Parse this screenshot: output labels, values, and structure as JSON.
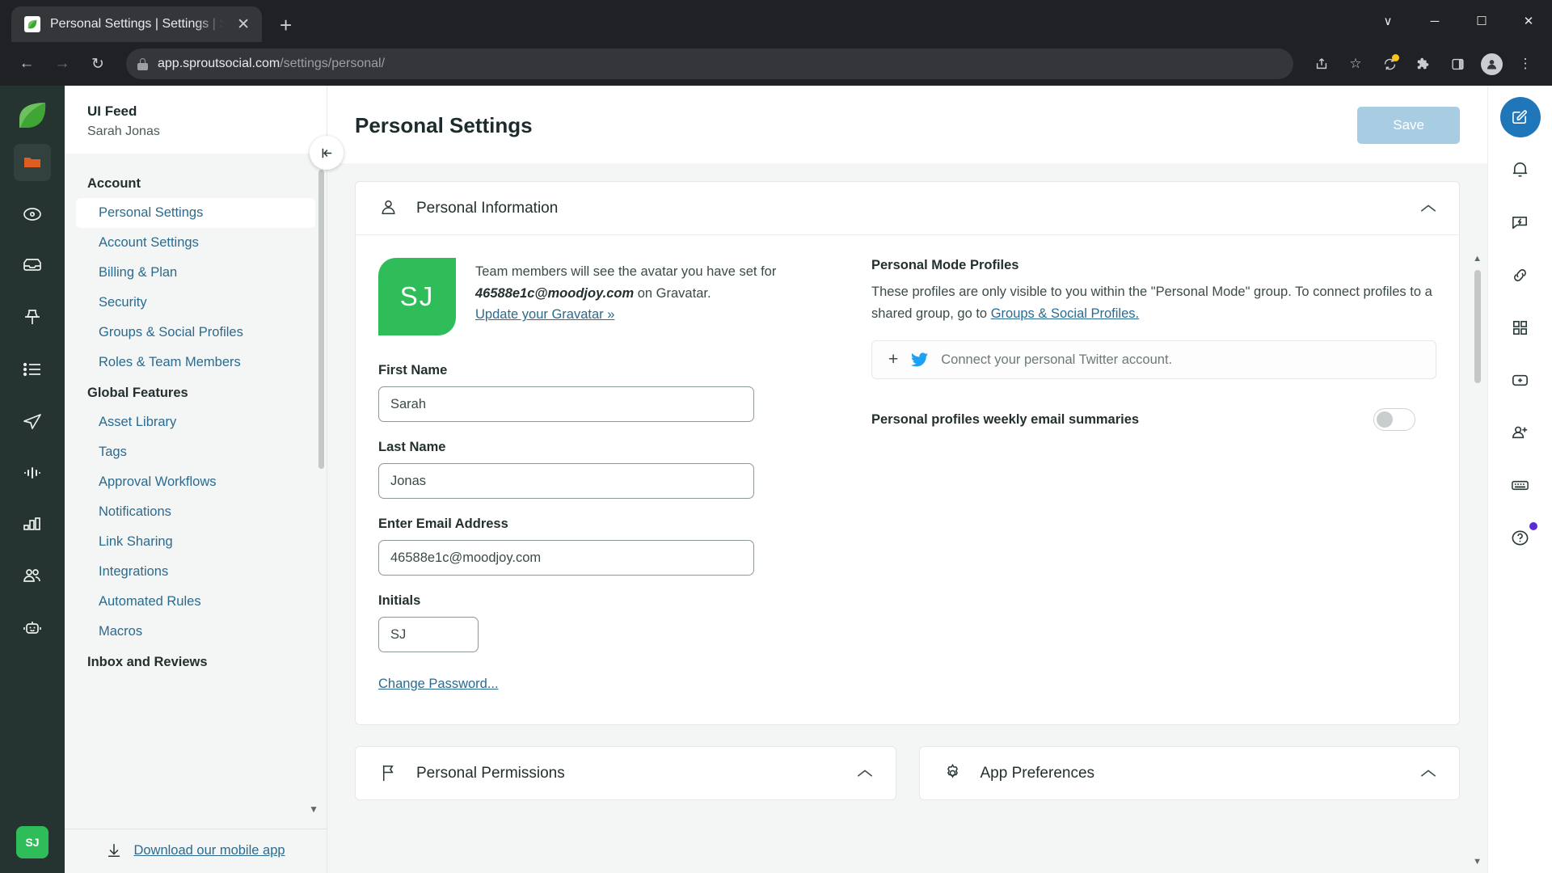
{
  "browser": {
    "tab_title": "Personal Settings | Settings | Spr",
    "tab_close": "✕",
    "new_tab": "+",
    "url_host": "app.sproutsocial.com",
    "url_path": "/settings/personal/",
    "window_minimize": "─",
    "window_maximize": "☐",
    "window_close": "✕",
    "window_chevron": "∨",
    "back": "←",
    "forward": "→",
    "reload": "↻",
    "share_icon": "share-icon",
    "bookmark_icon": "☆",
    "extensions_icon": "🧩",
    "sidepanel_icon": "◨",
    "menu_icon": "⋮"
  },
  "left_rail": {
    "logo": "sprout-leaf-logo",
    "items": [
      "folder-icon",
      "compass-icon",
      "inbox-icon",
      "pin-icon",
      "list-icon",
      "send-icon",
      "pulse-icon",
      "bar-chart-icon",
      "people-icon",
      "bot-icon"
    ],
    "avatar_initials": "SJ"
  },
  "sidebar": {
    "org": "UI Feed",
    "user": "Sarah Jonas",
    "collapse_icon": "|←",
    "groups": [
      {
        "title": "Account",
        "items": [
          {
            "label": "Personal Settings",
            "selected": true
          },
          {
            "label": "Account Settings",
            "selected": false
          },
          {
            "label": "Billing & Plan",
            "selected": false
          },
          {
            "label": "Security",
            "selected": false
          },
          {
            "label": "Groups & Social Profiles",
            "selected": false
          },
          {
            "label": "Roles & Team Members",
            "selected": false
          }
        ]
      },
      {
        "title": "Global Features",
        "items": [
          {
            "label": "Asset Library",
            "selected": false
          },
          {
            "label": "Tags",
            "selected": false
          },
          {
            "label": "Approval Workflows",
            "selected": false
          },
          {
            "label": "Notifications",
            "selected": false
          },
          {
            "label": "Link Sharing",
            "selected": false
          },
          {
            "label": "Integrations",
            "selected": false
          },
          {
            "label": "Automated Rules",
            "selected": false
          },
          {
            "label": "Macros",
            "selected": false
          }
        ]
      },
      {
        "title": "Inbox and Reviews",
        "items": []
      }
    ],
    "footer_link": "Download our mobile app",
    "footer_icon": "download-icon",
    "scroll_caret": "▼"
  },
  "header": {
    "title": "Personal Settings",
    "save_label": "Save"
  },
  "personal_information": {
    "card_title": "Personal Information",
    "card_icon": "person-icon",
    "collapse_chevron": "∧",
    "avatar_initials": "SJ",
    "gravatar_text_1": "Team members will see the avatar you have set for",
    "gravatar_email": "46588e1c@moodjoy.com",
    "gravatar_text_2": " on Gravatar.",
    "gravatar_link": "Update your Gravatar »",
    "fields": [
      {
        "label": "First Name",
        "value": "Sarah",
        "size": "lg"
      },
      {
        "label": "Last Name",
        "value": "Jonas",
        "size": "lg"
      },
      {
        "label": "Enter Email Address",
        "value": "46588e1c@moodjoy.com",
        "size": "lg"
      },
      {
        "label": "Initials",
        "value": "SJ",
        "size": "sm"
      }
    ],
    "change_password": "Change Password..."
  },
  "personal_mode": {
    "title": "Personal Mode Profiles",
    "desc_1": "These profiles are only visible to you within the \"Personal Mode\" group. To connect profiles to a shared group, go to ",
    "desc_link": "Groups & Social Profiles.",
    "connect_label": "Connect your personal Twitter account.",
    "connect_plus": "+",
    "twitter_icon": "twitter-icon",
    "toggle_label": "Personal profiles weekly email summaries",
    "toggle_on": false
  },
  "bottom_cards": [
    {
      "title": "Personal Permissions",
      "icon": "flag-icon",
      "chevron": "∧"
    },
    {
      "title": "App Preferences",
      "icon": "gear-icon",
      "chevron": "∧"
    }
  ],
  "right_rail": {
    "items": [
      {
        "icon": "compose-icon",
        "primary": true,
        "dot": false
      },
      {
        "icon": "bell-icon",
        "primary": false,
        "dot": false
      },
      {
        "icon": "message-bolt-icon",
        "primary": false,
        "dot": false
      },
      {
        "icon": "link-icon",
        "primary": false,
        "dot": false
      },
      {
        "icon": "grid-icon",
        "primary": false,
        "dot": false
      },
      {
        "icon": "add-box-icon",
        "primary": false,
        "dot": false
      },
      {
        "icon": "add-person-icon",
        "primary": false,
        "dot": false
      },
      {
        "icon": "keyboard-icon",
        "primary": false,
        "dot": false
      },
      {
        "icon": "help-icon",
        "primary": false,
        "dot": true
      }
    ]
  },
  "colors": {
    "rail_bg": "#253331",
    "brand_green": "#2ebd59",
    "link_blue": "#2a6b8f",
    "save_disabled": "#a8cde2",
    "primary_blue": "#1f77b9",
    "twitter_blue": "#1da1f2"
  }
}
